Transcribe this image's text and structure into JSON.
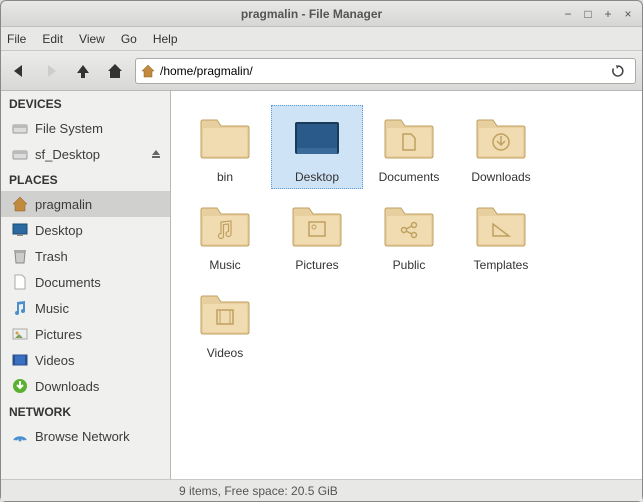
{
  "window": {
    "title": "pragmalin - File Manager"
  },
  "menu": {
    "file": "File",
    "edit": "Edit",
    "view": "View",
    "go": "Go",
    "help": "Help"
  },
  "path": "/home/pragmalin/",
  "sidebar": {
    "devices_header": "DEVICES",
    "devices": [
      {
        "label": "File System"
      },
      {
        "label": "sf_Desktop"
      }
    ],
    "places_header": "PLACES",
    "places": [
      {
        "label": "pragmalin"
      },
      {
        "label": "Desktop"
      },
      {
        "label": "Trash"
      },
      {
        "label": "Documents"
      },
      {
        "label": "Music"
      },
      {
        "label": "Pictures"
      },
      {
        "label": "Videos"
      },
      {
        "label": "Downloads"
      }
    ],
    "network_header": "NETWORK",
    "network": [
      {
        "label": "Browse Network"
      }
    ]
  },
  "folders": [
    {
      "label": "bin"
    },
    {
      "label": "Desktop"
    },
    {
      "label": "Documents"
    },
    {
      "label": "Downloads"
    },
    {
      "label": "Music"
    },
    {
      "label": "Pictures"
    },
    {
      "label": "Public"
    },
    {
      "label": "Templates"
    },
    {
      "label": "Videos"
    }
  ],
  "status": "9 items, Free space: 20.5 GiB"
}
